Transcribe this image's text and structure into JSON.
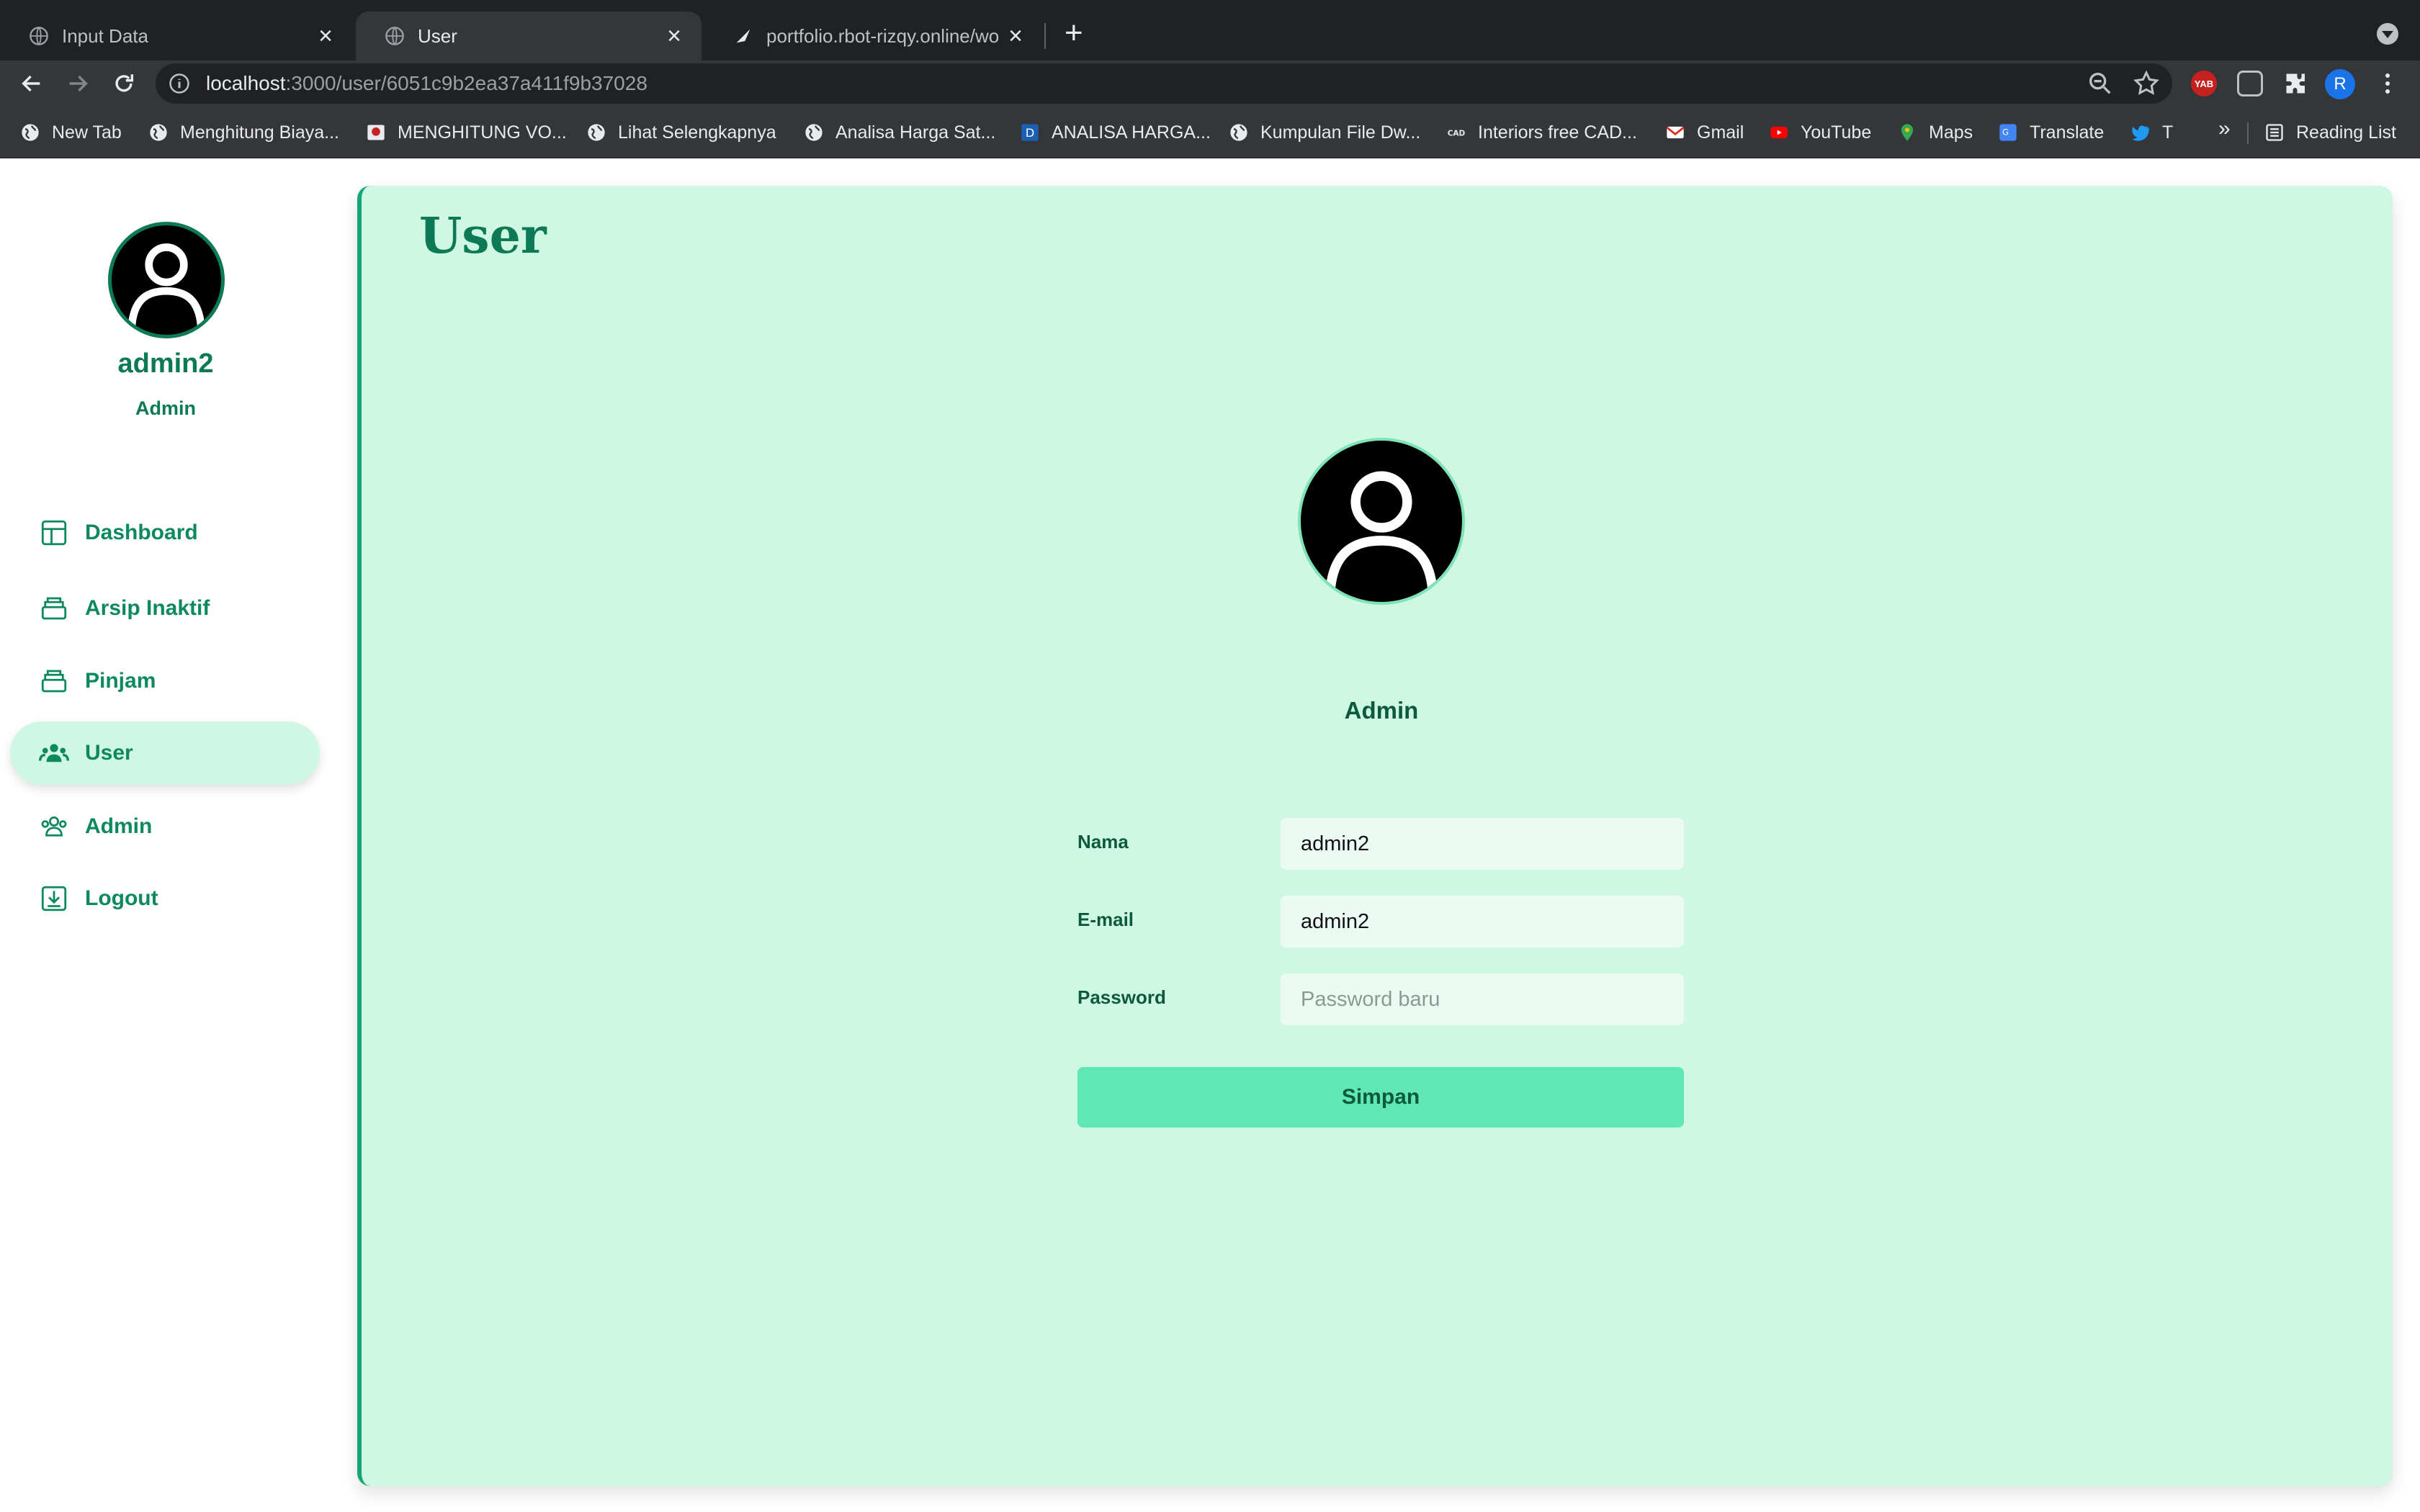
{
  "browser": {
    "tabs": [
      {
        "title": "Input Data",
        "active": false
      },
      {
        "title": "User",
        "active": true
      },
      {
        "title": "portfolio.rbot-rizqy.online/work",
        "active": false
      }
    ],
    "new_tab_label": "+",
    "close_glyph": "×",
    "url_host": "localhost",
    "url_path": ":3000/user/6051c9b2ea37a411f9b37028",
    "profile_initial": "R",
    "bookmarks": [
      {
        "label": "New Tab",
        "icon": "globe-icon"
      },
      {
        "label": "Menghitung Biaya...",
        "icon": "globe-icon"
      },
      {
        "label": "MENGHITUNG VO...",
        "icon": "site-icon"
      },
      {
        "label": "Lihat Selengkapnya",
        "icon": "globe-icon"
      },
      {
        "label": "Analisa Harga Sat...",
        "icon": "globe-icon"
      },
      {
        "label": "ANALISA HARGA...",
        "icon": "d-icon"
      },
      {
        "label": "Kumpulan File Dw...",
        "icon": "globe-icon"
      },
      {
        "label": "Interiors free CAD...",
        "icon": "cad-icon"
      },
      {
        "label": "Gmail",
        "icon": "gmail-icon"
      },
      {
        "label": "YouTube",
        "icon": "youtube-icon"
      },
      {
        "label": "Maps",
        "icon": "maps-icon"
      },
      {
        "label": "Translate",
        "icon": "translate-icon"
      },
      {
        "label": "T",
        "icon": "twitter-icon"
      }
    ],
    "more_bookmarks": "»",
    "reading_list": "Reading List",
    "ext_yab": "YAB"
  },
  "sidebar": {
    "username": "admin2",
    "role": "Admin",
    "items": [
      {
        "label": "Dashboard",
        "icon": "dashboard-icon",
        "active": false
      },
      {
        "label": "Arsip Inaktif",
        "icon": "archive-icon",
        "active": false
      },
      {
        "label": "Pinjam",
        "icon": "archive-icon",
        "active": false
      },
      {
        "label": "User",
        "icon": "users-icon",
        "active": true
      },
      {
        "label": "Admin",
        "icon": "admins-icon",
        "active": false
      },
      {
        "label": "Logout",
        "icon": "logout-icon",
        "active": false
      }
    ]
  },
  "main": {
    "title": "User",
    "role": "Admin",
    "form": {
      "nama_label": "Nama",
      "nama_value": "admin2",
      "email_label": "E-mail",
      "email_value": "admin2",
      "password_label": "Password",
      "password_placeholder": "Password baru",
      "save_label": "Simpan"
    }
  },
  "colors": {
    "accent": "#0c7a55",
    "panel_bg": "#cff7e4",
    "button_bg": "#61e6b5",
    "active_item_bg": "#d0f7e6"
  }
}
